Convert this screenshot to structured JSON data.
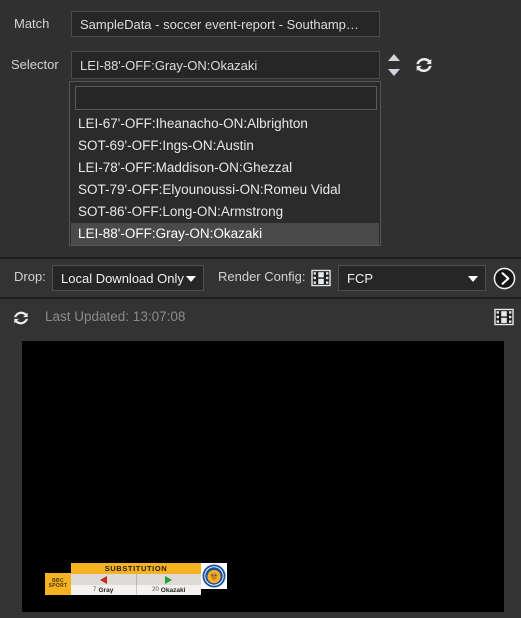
{
  "form": {
    "match_label": "Match",
    "match_value": "SampleData - soccer event-report - Southamp…",
    "selector_label": "Selector",
    "selector_value": "LEI-88'-OFF:Gray-ON:Okazaki",
    "spinner_icon": "up-down-spinner-icon",
    "refresh_icon": "refresh-icon"
  },
  "dropdown": {
    "search_value": "",
    "search_placeholder": "",
    "items": [
      {
        "label": "LEI-67'-OFF:Iheanacho-ON:Albrighton",
        "selected": false
      },
      {
        "label": "SOT-69'-OFF:Ings-ON:Austin",
        "selected": false
      },
      {
        "label": "LEI-78'-OFF:Maddison-ON:Ghezzal",
        "selected": false
      },
      {
        "label": "SOT-79'-OFF:Elyounoussi-ON:Romeu Vidal",
        "selected": false
      },
      {
        "label": "SOT-86'-OFF:Long-ON:Armstrong",
        "selected": false
      },
      {
        "label": "LEI-88'-OFF:Gray-ON:Okazaki",
        "selected": true
      }
    ]
  },
  "toolbar": {
    "drop_label": "Drop:",
    "drop_value": "Local Download Only",
    "render_config_label": "Render Config:",
    "render_config_value": "FCP",
    "film_icon": "film-strip-icon",
    "go_icon": "chevron-right-circle-icon"
  },
  "status": {
    "refresh_icon": "refresh-icon",
    "text": "Last Updated: 13:07:08",
    "film_icon": "film-strip-icon"
  },
  "preview": {
    "graphic": {
      "broadcaster_line1": "BBC",
      "broadcaster_line2": "SPORT",
      "title": "SUBSTITUTION",
      "off_arrow": "arrow-left-red-icon",
      "on_arrow": "arrow-right-green-icon",
      "off_number": "7",
      "off_player": "Gray",
      "on_number": "20",
      "on_player": "Okazaki",
      "badge": "leicester-city-crest-icon"
    }
  },
  "colors": {
    "window_bg": "#303030",
    "panel_bg": "#333333",
    "field_bg": "#262626",
    "text": "#dcdcdc",
    "muted_text": "#8b8b8b",
    "highlight": "#4a4a4a",
    "accent_yellow": "#f5b222",
    "off_red": "#c32a22",
    "on_green": "#23a03c",
    "video_bg": "#000000"
  }
}
